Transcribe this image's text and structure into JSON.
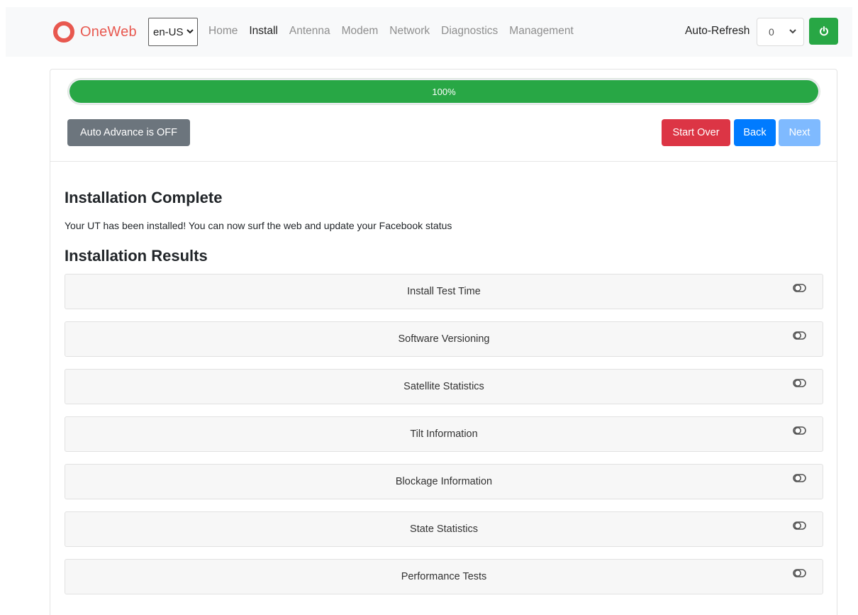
{
  "brand": {
    "name": "OneWeb",
    "color": "#e8584f"
  },
  "language": {
    "selected": "en-US"
  },
  "nav": {
    "items": [
      {
        "label": "Home",
        "active": false
      },
      {
        "label": "Install",
        "active": true
      },
      {
        "label": "Antenna",
        "active": false
      },
      {
        "label": "Modem",
        "active": false
      },
      {
        "label": "Network",
        "active": false
      },
      {
        "label": "Diagnostics",
        "active": false
      },
      {
        "label": "Management",
        "active": false
      }
    ]
  },
  "auto_refresh": {
    "label": "Auto-Refresh",
    "value": "0"
  },
  "power": {
    "icon": "power-icon",
    "color": "#28a745"
  },
  "progress": {
    "value": 100,
    "label": "100%",
    "color": "#28a745"
  },
  "buttons": {
    "auto_advance": "Auto Advance is OFF",
    "start_over": "Start Over",
    "back": "Back",
    "next": "Next"
  },
  "content": {
    "title": "Installation Complete",
    "message": "Your UT has been installed! You can now surf the web and update your Facebook status",
    "results_title": "Installation Results"
  },
  "results": [
    {
      "label": "Install Test Time",
      "icon": "toggle-icon"
    },
    {
      "label": "Software Versioning",
      "icon": "toggle-icon"
    },
    {
      "label": "Satellite Statistics",
      "icon": "toggle-icon"
    },
    {
      "label": "Tilt Information",
      "icon": "toggle-icon"
    },
    {
      "label": "Blockage Information",
      "icon": "toggle-icon"
    },
    {
      "label": "State Statistics",
      "icon": "toggle-icon"
    },
    {
      "label": "Performance Tests",
      "icon": "toggle-icon"
    }
  ]
}
